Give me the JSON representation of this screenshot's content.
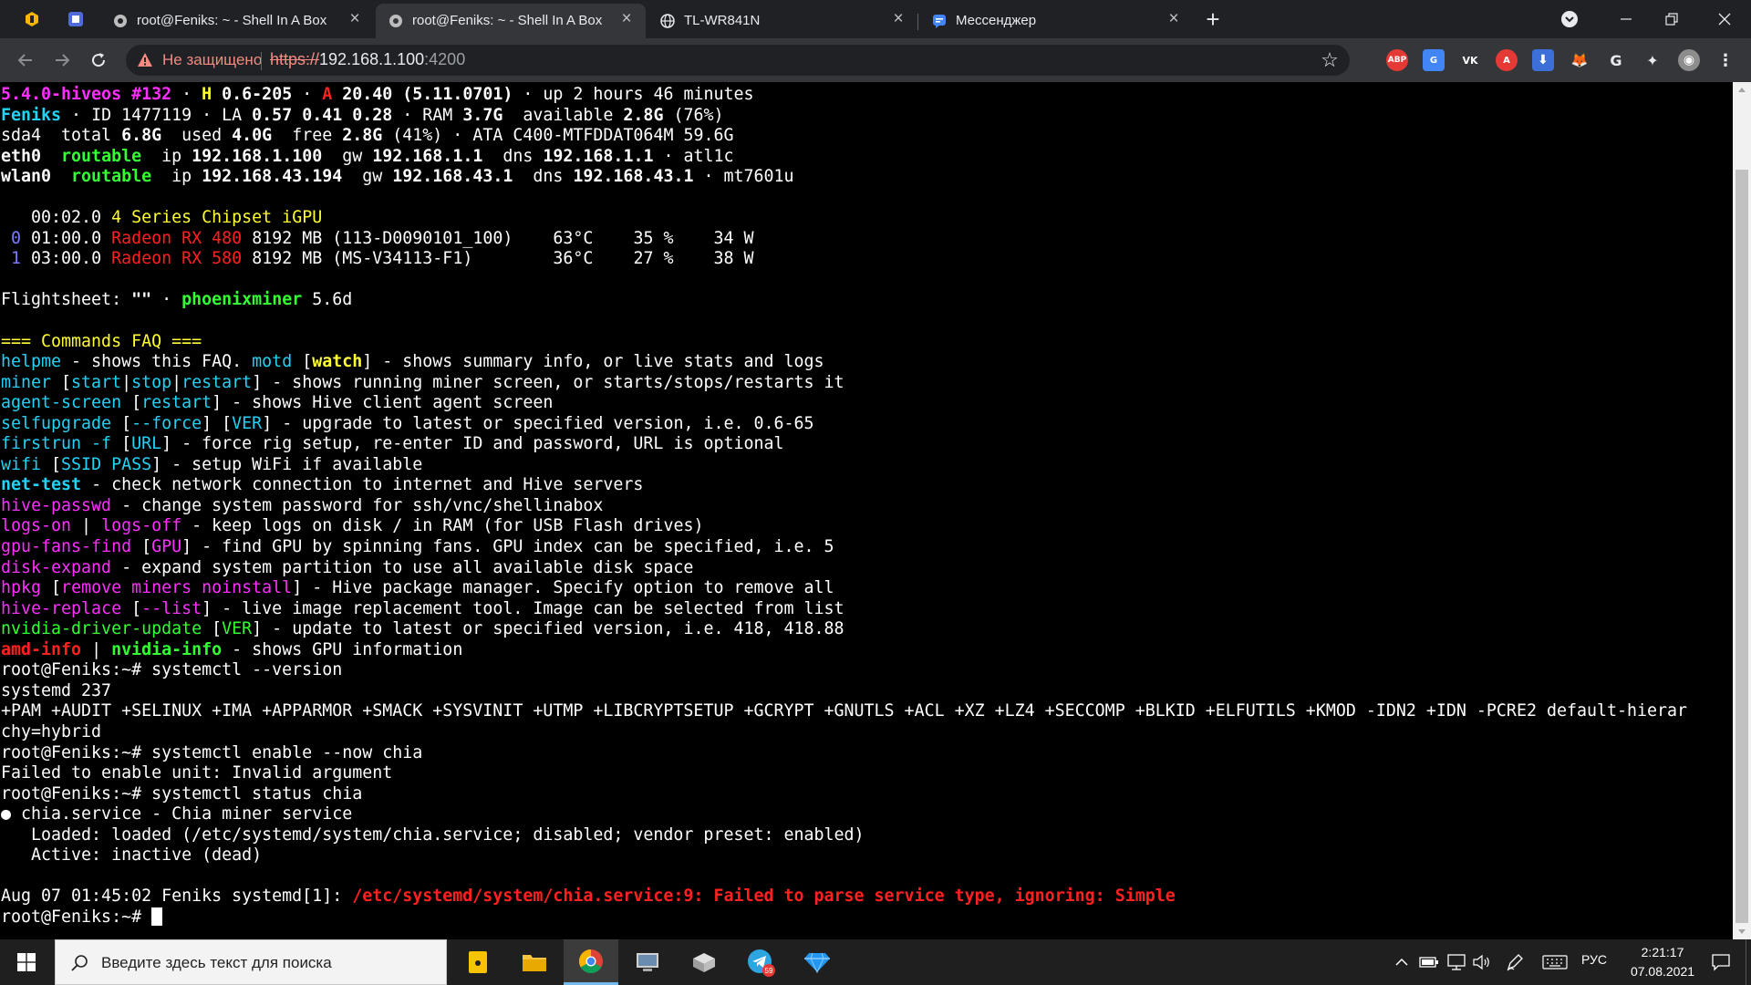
{
  "browser": {
    "tabs": [
      {
        "title": "root@Feniks: ~ - Shell In A Box",
        "active": false
      },
      {
        "title": "root@Feniks: ~ - Shell In A Box",
        "active": true
      },
      {
        "title": "TL-WR841N",
        "active": false
      },
      {
        "title": "Мессенджер",
        "active": false
      }
    ],
    "new_tab_label": "+",
    "security_label": "Не защищено",
    "url": {
      "scheme": "https://",
      "host": "192.168.1.100",
      "port": ":4200"
    },
    "extensions": [
      "ABP",
      "G",
      "VK",
      "A",
      "⬇",
      "🦊",
      "G",
      "✦",
      "◉"
    ]
  },
  "colors": {
    "accent_blue": "#76b9ed",
    "warn_red": "#f28b82",
    "term_green": "#33ff33",
    "term_cyan": "#22d3f5",
    "term_yellow": "#ffff33",
    "term_magenta": "#ff2fff",
    "term_red": "#ff2020"
  },
  "terminal": {
    "lines": [
      [
        [
          "5.4.0-hiveos #132",
          "m",
          1
        ],
        [
          " · ",
          "w"
        ],
        [
          "H",
          "y",
          1
        ],
        [
          " 0.6-205 ",
          "w",
          1
        ],
        [
          "· ",
          "w"
        ],
        [
          "A",
          "r",
          1
        ],
        [
          " 20.40 (5.11.0701)",
          "w",
          1
        ],
        [
          " · up 2 hours 46 minutes",
          "w"
        ]
      ],
      [
        [
          "Feniks",
          "c",
          1
        ],
        [
          " · ID 1477119 · LA ",
          "w"
        ],
        [
          "0.57 0.41 0.28",
          "w",
          1
        ],
        [
          " · RAM ",
          "w"
        ],
        [
          "3.7G",
          "w",
          1
        ],
        [
          "  available ",
          "w"
        ],
        [
          "2.8G",
          "w",
          1
        ],
        [
          " (76%)",
          "w"
        ]
      ],
      [
        [
          "sda4  total ",
          "w"
        ],
        [
          "6.8G",
          "w",
          1
        ],
        [
          "  used ",
          "w"
        ],
        [
          "4.0G",
          "w",
          1
        ],
        [
          "  free ",
          "w"
        ],
        [
          "2.8G",
          "w",
          1
        ],
        [
          " (41%) · ATA C400-MTFDDAT064M 59.6G",
          "w"
        ]
      ],
      [
        [
          "eth0",
          "w",
          1
        ],
        [
          "  ",
          "w"
        ],
        [
          "routable",
          "g",
          1
        ],
        [
          "  ip ",
          "w"
        ],
        [
          "192.168.1.100",
          "w",
          1
        ],
        [
          "  gw ",
          "w"
        ],
        [
          "192.168.1.1",
          "w",
          1
        ],
        [
          "  dns ",
          "w"
        ],
        [
          "192.168.1.1",
          "w",
          1
        ],
        [
          " · atl1c",
          "w"
        ]
      ],
      [
        [
          "wlan0",
          "w",
          1
        ],
        [
          "  ",
          "w"
        ],
        [
          "routable",
          "g",
          1
        ],
        [
          "  ip ",
          "w"
        ],
        [
          "192.168.43.194",
          "w",
          1
        ],
        [
          "  gw ",
          "w"
        ],
        [
          "192.168.43.1",
          "w",
          1
        ],
        [
          "  dns ",
          "w"
        ],
        [
          "192.168.43.1",
          "w",
          1
        ],
        [
          " · mt7601u",
          "w"
        ]
      ],
      [],
      [
        [
          "   00:02.0 ",
          "w"
        ],
        [
          "4 Series Chipset iGPU",
          "y"
        ]
      ],
      [
        [
          " 0 ",
          "b"
        ],
        [
          "01:00.0 ",
          "w"
        ],
        [
          "Radeon RX 480",
          "r"
        ],
        [
          " 8192 MB (113-D0090101_100)    ",
          "w"
        ],
        [
          "63°C    35 %    34 W",
          "w"
        ]
      ],
      [
        [
          " 1 ",
          "b"
        ],
        [
          "03:00.0 ",
          "w"
        ],
        [
          "Radeon RX 580",
          "r"
        ],
        [
          " 8192 MB (MS-V34113-F1)        ",
          "w"
        ],
        [
          "36°C    27 %    38 W",
          "w"
        ]
      ],
      [],
      [
        [
          "Flightsheet: ",
          "w"
        ],
        [
          "\"\"",
          "w",
          1
        ],
        [
          " · ",
          "w"
        ],
        [
          "phoenixminer",
          "g",
          1
        ],
        [
          " 5.6d",
          "w"
        ]
      ],
      [],
      [
        [
          "=== Commands FAQ ===",
          "y"
        ]
      ],
      [
        [
          "helpme",
          "c"
        ],
        [
          " - shows this FAQ. ",
          "w"
        ],
        [
          "motd",
          "c"
        ],
        [
          " [",
          "w"
        ],
        [
          "watch",
          "y",
          1
        ],
        [
          "] - shows summary info, or live stats and logs",
          "w"
        ]
      ],
      [
        [
          "miner",
          "c"
        ],
        [
          " [",
          "w"
        ],
        [
          "start",
          "c"
        ],
        [
          "|",
          "w"
        ],
        [
          "stop",
          "c"
        ],
        [
          "|",
          "w"
        ],
        [
          "restart",
          "c"
        ],
        [
          "] - shows running miner screen, or starts/stops/restarts it",
          "w"
        ]
      ],
      [
        [
          "agent-screen",
          "c"
        ],
        [
          " [",
          "w"
        ],
        [
          "restart",
          "c"
        ],
        [
          "] - shows Hive client agent screen",
          "w"
        ]
      ],
      [
        [
          "selfupgrade",
          "c"
        ],
        [
          " [",
          "w"
        ],
        [
          "--force",
          "c"
        ],
        [
          "] [",
          "w"
        ],
        [
          "VER",
          "c"
        ],
        [
          "] - upgrade to latest or specified version, i.e. 0.6-65",
          "w"
        ]
      ],
      [
        [
          "firstrun -f",
          "c"
        ],
        [
          " [",
          "w"
        ],
        [
          "URL",
          "c"
        ],
        [
          "] - force rig setup, re-enter ID and password, URL is optional",
          "w"
        ]
      ],
      [
        [
          "wifi",
          "c"
        ],
        [
          " [",
          "w"
        ],
        [
          "SSID PASS",
          "c"
        ],
        [
          "] - setup WiFi if available",
          "w"
        ]
      ],
      [
        [
          "net-test",
          "c",
          1
        ],
        [
          " - check network connection to internet and Hive servers",
          "w"
        ]
      ],
      [
        [
          "hive-passwd",
          "m"
        ],
        [
          " - change system password for ssh/vnc/shellinabox",
          "w"
        ]
      ],
      [
        [
          "logs-on",
          "m"
        ],
        [
          " | ",
          "w"
        ],
        [
          "logs-off",
          "m"
        ],
        [
          " - keep logs on disk / in RAM (for USB Flash drives)",
          "w"
        ]
      ],
      [
        [
          "gpu-fans-find",
          "m"
        ],
        [
          " [",
          "w"
        ],
        [
          "GPU",
          "m"
        ],
        [
          "] - find GPU by spinning fans. GPU index can be specified, i.e. 5",
          "w"
        ]
      ],
      [
        [
          "disk-expand",
          "m"
        ],
        [
          " - expand system partition to use all available disk space",
          "w"
        ]
      ],
      [
        [
          "hpkg",
          "m"
        ],
        [
          " [",
          "w"
        ],
        [
          "remove miners noinstall",
          "m"
        ],
        [
          "] - Hive package manager. Specify option to remove all",
          "w"
        ]
      ],
      [
        [
          "hive-replace",
          "m"
        ],
        [
          " [",
          "w"
        ],
        [
          "--list",
          "m"
        ],
        [
          "] - live image replacement tool. Image can be selected from list",
          "w"
        ]
      ],
      [
        [
          "nvidia-driver-update",
          "g"
        ],
        [
          " [",
          "w"
        ],
        [
          "VER",
          "g"
        ],
        [
          "] - update to latest or specified version, i.e. 418, 418.88",
          "w"
        ]
      ],
      [
        [
          "amd-info",
          "r",
          1
        ],
        [
          " | ",
          "w"
        ],
        [
          "nvidia-info",
          "g",
          1
        ],
        [
          " - shows GPU information",
          "w"
        ]
      ],
      [
        [
          "root@Feniks:~# systemctl --version",
          "w"
        ]
      ],
      [
        [
          "systemd 237",
          "w"
        ]
      ],
      [
        [
          "+PAM +AUDIT +SELINUX +IMA +APPARMOR +SMACK +SYSVINIT +UTMP +LIBCRYPTSETUP +GCRYPT +GNUTLS +ACL +XZ +LZ4 +SECCOMP +BLKID +ELFUTILS +KMOD -IDN2 +IDN -PCRE2 default-hierar",
          "w"
        ]
      ],
      [
        [
          "chy=hybrid",
          "w"
        ]
      ],
      [
        [
          "root@Feniks:~# systemctl enable --now chia",
          "w"
        ]
      ],
      [
        [
          "Failed to enable unit: Invalid argument",
          "w"
        ]
      ],
      [
        [
          "root@Feniks:~# systemctl status chia",
          "w"
        ]
      ],
      [
        [
          "● chia.service - Chia miner service",
          "w"
        ]
      ],
      [
        [
          "   Loaded: loaded (/etc/systemd/system/chia.service; disabled; vendor preset: enabled)",
          "w"
        ]
      ],
      [
        [
          "   Active: inactive (dead)",
          "w"
        ]
      ],
      [],
      [
        [
          "Aug 07 01:45:02 Feniks systemd[1]: ",
          "w"
        ],
        [
          "/etc/systemd/system/chia.service:9: Failed to parse service type, ignoring: Simple",
          "r",
          1
        ]
      ],
      [
        [
          "root@Feniks:~# ",
          "w"
        ]
      ]
    ]
  },
  "taskbar": {
    "search_placeholder": "Введите здесь текст для поиска",
    "telegram_badge": "59",
    "language": "РУС",
    "time": "2:21:17",
    "date": "07.08.2021"
  }
}
